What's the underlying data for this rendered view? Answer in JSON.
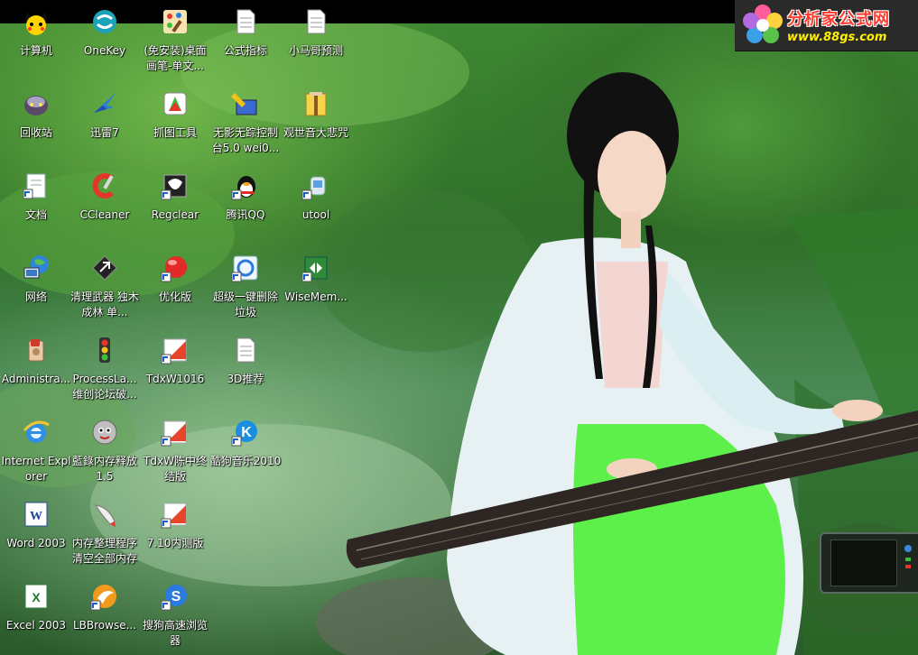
{
  "logo": {
    "title": "分析家公式网",
    "url": "www.88gs.com"
  },
  "icons": [
    {
      "id": "computer",
      "label": "计算机"
    },
    {
      "id": "onekey",
      "label": "OneKey"
    },
    {
      "id": "paint",
      "label": "(免安装)桌面画笔-单文..."
    },
    {
      "id": "formula",
      "label": "公式指标"
    },
    {
      "id": "xiaoma",
      "label": "小马哥预测"
    },
    {
      "id": "recycle",
      "label": "回收站"
    },
    {
      "id": "xunlei",
      "label": "迅雷7"
    },
    {
      "id": "capture",
      "label": "抓图工具"
    },
    {
      "id": "wuying",
      "label": "无影无踪控制台5.0 wei0..."
    },
    {
      "id": "guanyin",
      "label": "观世音大悲咒"
    },
    {
      "id": "docs",
      "label": "文档"
    },
    {
      "id": "ccleaner",
      "label": "CCleaner"
    },
    {
      "id": "regclear",
      "label": "Regclear"
    },
    {
      "id": "qq",
      "label": "腾讯QQ"
    },
    {
      "id": "utool",
      "label": "utool"
    },
    {
      "id": "network",
      "label": "网络"
    },
    {
      "id": "cleanweapon",
      "label": "清理武器 独木成林 单..."
    },
    {
      "id": "optimize",
      "label": "优化版"
    },
    {
      "id": "superdelete",
      "label": "超级一键删除垃圾"
    },
    {
      "id": "wisemem",
      "label": "WiseMem..."
    },
    {
      "id": "admin",
      "label": "Administra..."
    },
    {
      "id": "processla",
      "label": "ProcessLa... 维创论坛破..."
    },
    {
      "id": "tdx1016",
      "label": "TdxW1016"
    },
    {
      "id": "3d",
      "label": "3D推荐"
    },
    {
      "id": "ie",
      "label": "Internet Explorer"
    },
    {
      "id": "lanlu",
      "label": "藍錄内存释放1.5"
    },
    {
      "id": "tdxchen",
      "label": "TdxW陈中终结版"
    },
    {
      "id": "kugou",
      "label": "酷狗音乐2010"
    },
    {
      "id": "word",
      "label": "Word 2003"
    },
    {
      "id": "memclean",
      "label": "内存整理程序清空全部内存"
    },
    {
      "id": "710",
      "label": "7.10内测版"
    },
    {
      "id": "excel",
      "label": "Excel 2003"
    },
    {
      "id": "lbbrowser",
      "label": "LBBrowse..."
    },
    {
      "id": "sogou",
      "label": "搜狗高速浏览器"
    }
  ]
}
